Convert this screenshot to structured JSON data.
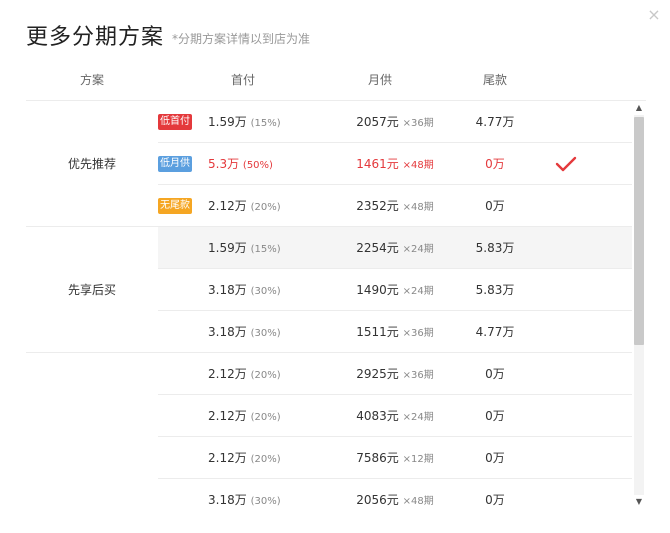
{
  "header": {
    "title": "更多分期方案",
    "subtitle": "*分期方案详情以到店为准",
    "close_icon": "×"
  },
  "columns": {
    "plan": "方案",
    "down": "首付",
    "monthly": "月供",
    "balloon": "尾款"
  },
  "groups": [
    {
      "label": "优先推荐"
    },
    {
      "label": "先享后买"
    },
    {
      "label": ""
    }
  ],
  "tags": {
    "low_down": {
      "label": "低首付",
      "color": "#e4393c"
    },
    "low_monthly": {
      "label": "低月供",
      "color": "#5b9fdf"
    },
    "no_balloon": {
      "label": "无尾款",
      "color": "#f5a623"
    }
  },
  "rows": [
    {
      "down": "1.59万",
      "pct": "(15%)",
      "monthly": "2057元",
      "term": "×36期",
      "balloon": "4.77万"
    },
    {
      "down": "5.3万",
      "pct": "(50%)",
      "monthly": "1461元",
      "term": "×48期",
      "balloon": "0万",
      "selected": true
    },
    {
      "down": "2.12万",
      "pct": "(20%)",
      "monthly": "2352元",
      "term": "×48期",
      "balloon": "0万"
    },
    {
      "down": "1.59万",
      "pct": "(15%)",
      "monthly": "2254元",
      "term": "×24期",
      "balloon": "5.83万",
      "hover": true
    },
    {
      "down": "3.18万",
      "pct": "(30%)",
      "monthly": "1490元",
      "term": "×24期",
      "balloon": "5.83万"
    },
    {
      "down": "3.18万",
      "pct": "(30%)",
      "monthly": "1511元",
      "term": "×36期",
      "balloon": "4.77万"
    },
    {
      "down": "2.12万",
      "pct": "(20%)",
      "monthly": "2925元",
      "term": "×36期",
      "balloon": "0万"
    },
    {
      "down": "2.12万",
      "pct": "(20%)",
      "monthly": "4083元",
      "term": "×24期",
      "balloon": "0万"
    },
    {
      "down": "2.12万",
      "pct": "(20%)",
      "monthly": "7586元",
      "term": "×12期",
      "balloon": "0万"
    },
    {
      "down": "3.18万",
      "pct": "(30%)",
      "monthly": "2056元",
      "term": "×48期",
      "balloon": "0万"
    }
  ],
  "selected_check_color": "#e4393c",
  "scrollbar": {
    "up_icon": "▲",
    "down_icon": "▼"
  }
}
